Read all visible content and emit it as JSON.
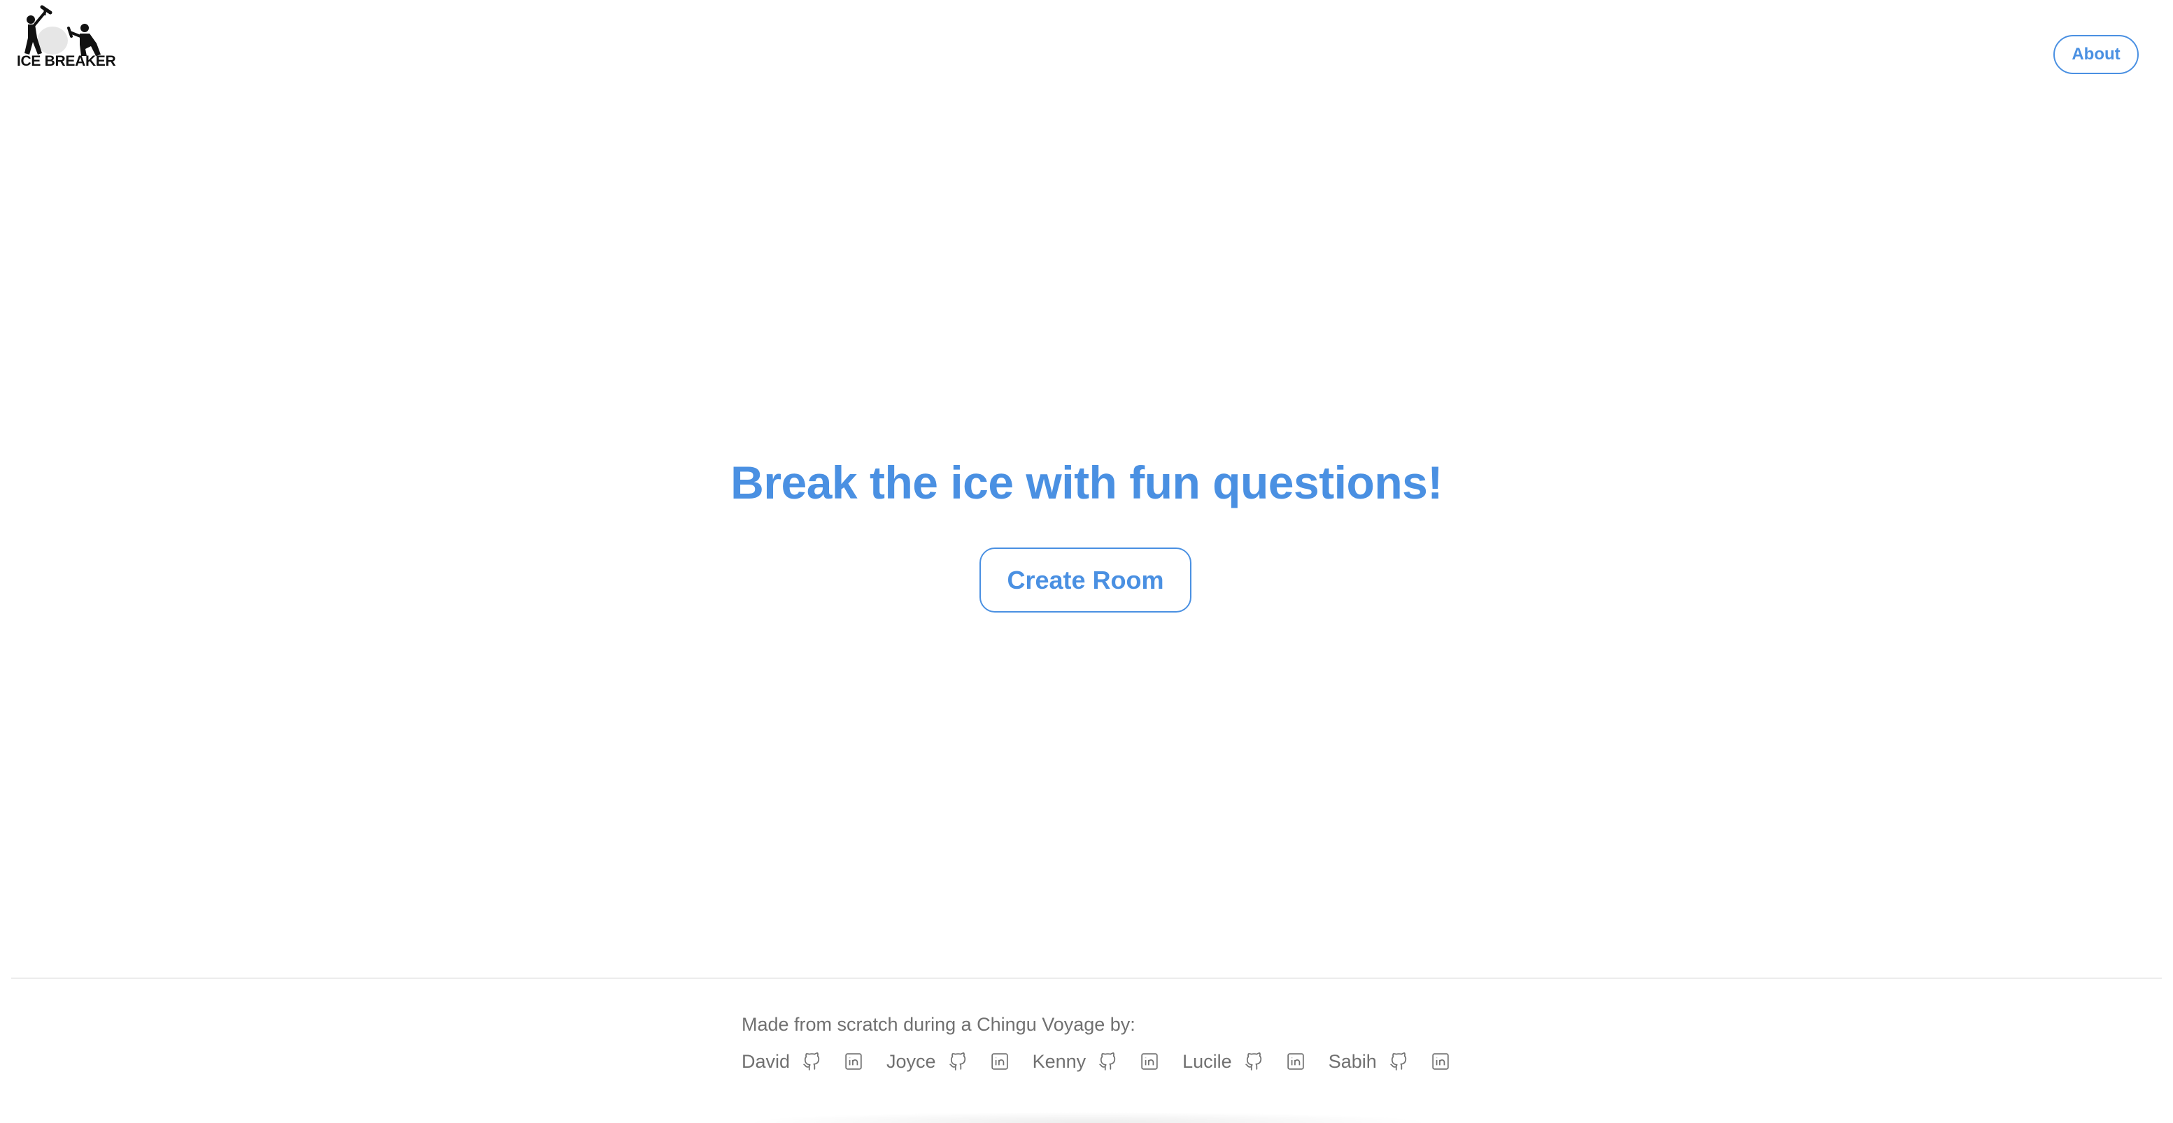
{
  "header": {
    "logo_text": "ICE BREAKER",
    "about_label": "About"
  },
  "hero": {
    "title": "Break the ice with fun questions!",
    "create_room_label": "Create Room"
  },
  "footer": {
    "caption": "Made from scratch during a Chingu Voyage by:",
    "members": [
      {
        "name": "David",
        "icons": [
          "github-icon",
          "linkedin-icon"
        ]
      },
      {
        "name": "Joyce",
        "icons": [
          "github-icon",
          "linkedin-icon"
        ]
      },
      {
        "name": "Kenny",
        "icons": [
          "github-icon",
          "linkedin-icon"
        ]
      },
      {
        "name": "Lucile",
        "icons": [
          "github-icon",
          "linkedin-icon"
        ]
      },
      {
        "name": "Sabih",
        "icons": [
          "github-icon",
          "linkedin-icon"
        ]
      }
    ]
  },
  "colors": {
    "accent": "#4a90e2",
    "muted_text": "#707070",
    "divider": "#ececec"
  }
}
